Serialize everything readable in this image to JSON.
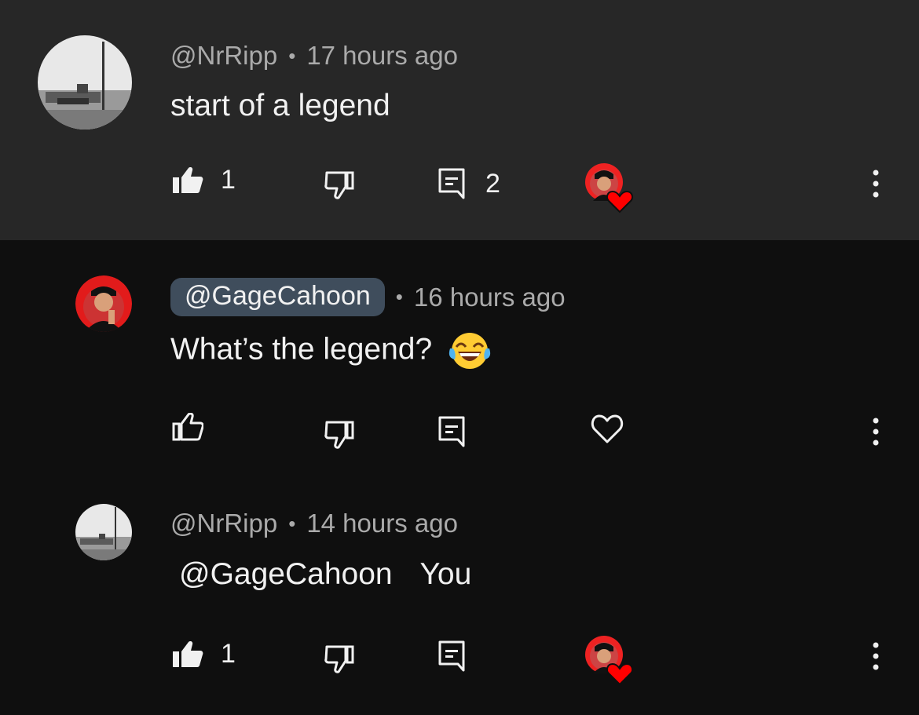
{
  "comments": [
    {
      "author": "@NrRipp",
      "time": "17 hours ago",
      "text": "start of a legend",
      "likes": "1",
      "replies": "2",
      "liked": true,
      "creator_hearted": true
    },
    {
      "author": "@GageCahoon",
      "time": "16 hours ago",
      "text": "What’s the legend?",
      "emoji": "face-with-tears-of-joy",
      "is_creator": true,
      "liked": false,
      "creator_hearted": false
    },
    {
      "author": "@NrRipp",
      "time": "14 hours ago",
      "mention": "@GageCahoon",
      "text": "You",
      "likes": "1",
      "liked": true,
      "creator_hearted": true
    }
  ],
  "separator": "•",
  "colors": {
    "top_bg": "#272727",
    "reply_bg": "#0f0f0f",
    "text_primary": "#f1f1f1",
    "text_secondary": "#aaaaaa",
    "creator_chip": "#3f4d5c",
    "heart_red": "#ff0000"
  }
}
